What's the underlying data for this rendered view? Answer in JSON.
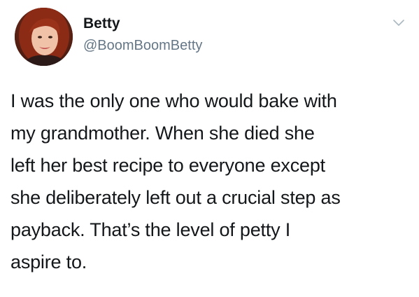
{
  "author": {
    "display_name": "Betty",
    "handle": "@BoomBoomBetty",
    "avatar_icon": "profile-photo"
  },
  "menu": {
    "icon": "chevron-down-icon"
  },
  "tweet": {
    "lines": [
      "I was the only one who would bake with",
      "my grandmother. When she died she",
      "left her best recipe to everyone except",
      "she deliberately left out a crucial step as",
      "payback. That’s the level of petty I",
      "aspire to."
    ]
  },
  "colors": {
    "text": "#14171a",
    "secondary": "#657786",
    "chevron": "#aab8c2"
  }
}
